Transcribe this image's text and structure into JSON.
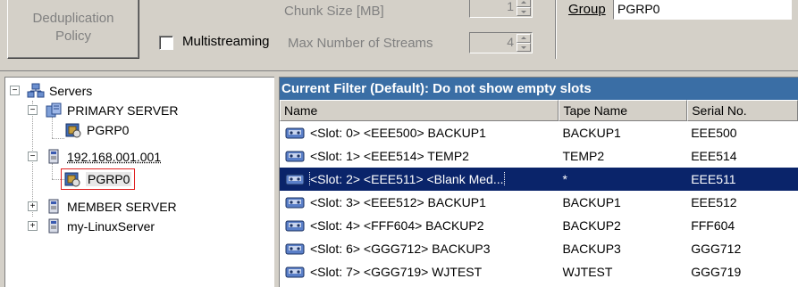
{
  "toolbar": {
    "dedup_button": [
      "Deduplication",
      "Policy"
    ],
    "multistreaming_label": "Multistreaming",
    "chunk_size_label": "Chunk Size [MB]",
    "chunk_size_value": "1",
    "max_streams_label": "Max Number of Streams",
    "max_streams_value": "4",
    "group_label": "Group",
    "group_value": "PGRP0"
  },
  "tree": {
    "root": "Servers",
    "items": [
      {
        "label": "PRIMARY SERVER",
        "icon": "server-group-icon"
      },
      {
        "label": "PGRP0",
        "icon": "library-icon"
      },
      {
        "label": "192.168.001.001",
        "icon": "computer-icon"
      },
      {
        "label": "PGRP0",
        "icon": "library-icon"
      },
      {
        "label": "MEMBER SERVER",
        "icon": "computer-icon"
      },
      {
        "label": "my-LinuxServer",
        "icon": "computer-icon"
      }
    ]
  },
  "list": {
    "filter_text": "Current Filter (Default):  Do not show empty slots",
    "columns": [
      "Name",
      "Tape Name",
      "Serial No."
    ],
    "rows": [
      {
        "name": "<Slot:  0> <EEE500> BACKUP1",
        "tape": "BACKUP1",
        "serial": "EEE500"
      },
      {
        "name": "<Slot:  1> <EEE514> TEMP2",
        "tape": "TEMP2",
        "serial": "EEE514"
      },
      {
        "name": "<Slot:  2> <EEE511> <Blank Med...",
        "tape": "*",
        "serial": "EEE511"
      },
      {
        "name": "<Slot:  3> <EEE512> BACKUP1",
        "tape": "BACKUP1",
        "serial": "EEE512"
      },
      {
        "name": "<Slot:  4> <FFF604> BACKUP2",
        "tape": "BACKUP2",
        "serial": "FFF604"
      },
      {
        "name": "<Slot:  6> <GGG712> BACKUP3",
        "tape": "BACKUP3",
        "serial": "GGG712"
      },
      {
        "name": "<Slot:  7> <GGG719> WJTEST",
        "tape": "WJTEST",
        "serial": "GGG719"
      }
    ],
    "selected_row": 2
  },
  "colors": {
    "filter_bar": "#3a6ea5",
    "selection": "#0a246a",
    "highlight_box": "#e02020"
  }
}
